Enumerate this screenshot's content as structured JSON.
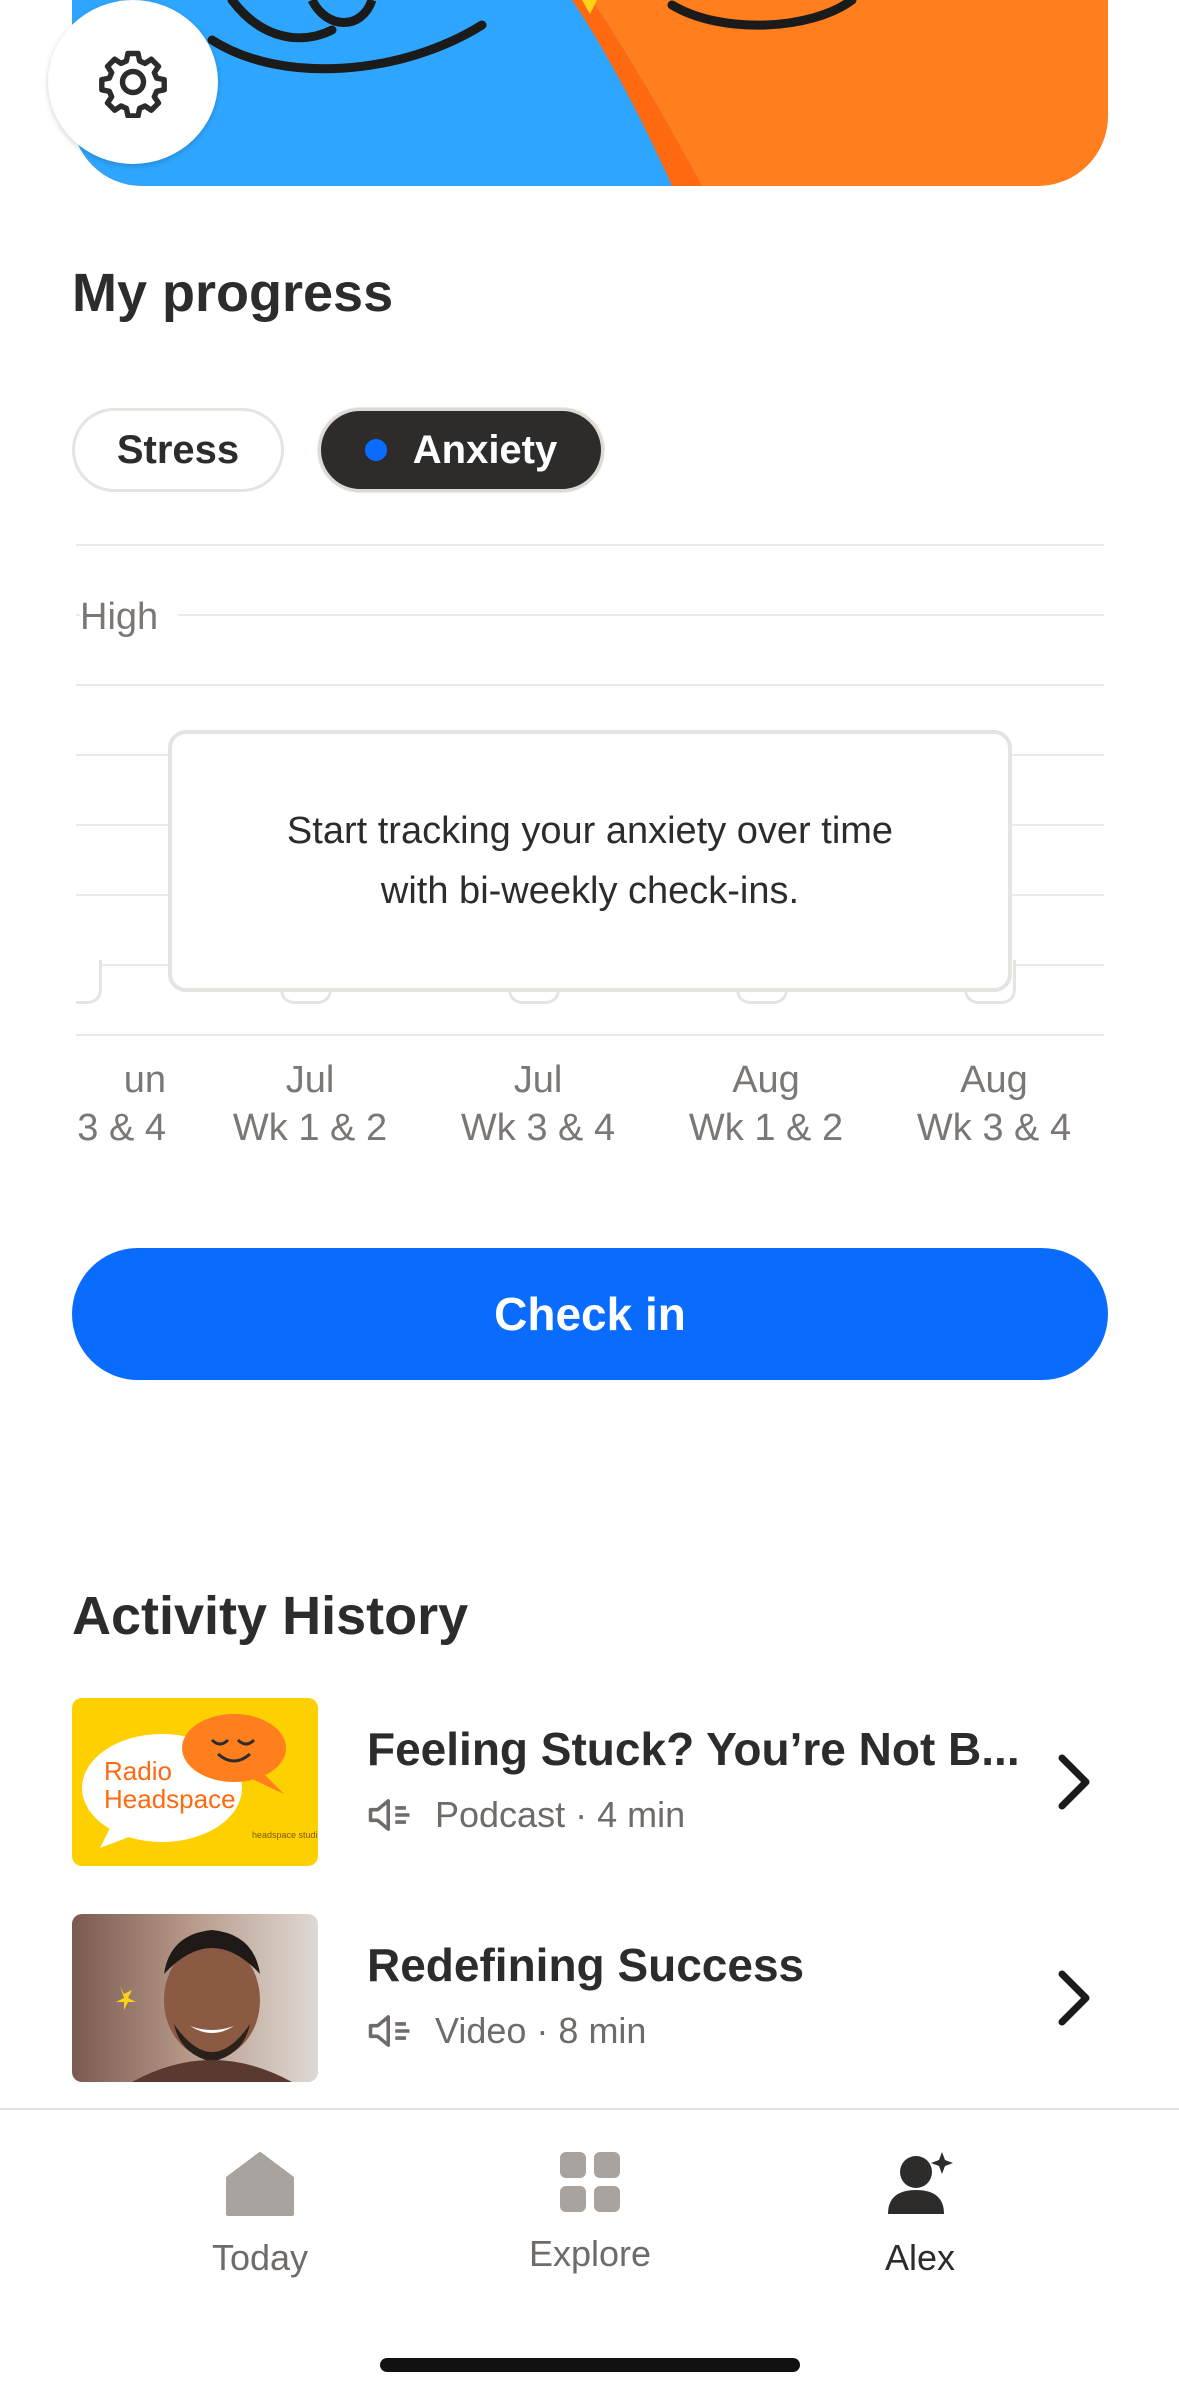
{
  "header": {
    "settings_icon": "gear-icon"
  },
  "progress": {
    "title": "My progress",
    "tabs": [
      {
        "label": "Stress",
        "active": false
      },
      {
        "label": "Anxiety",
        "active": true
      }
    ],
    "chart": {
      "y_label": "High",
      "empty_message_line1": "Start tracking your anxiety over time",
      "empty_message_line2": "with bi-weekly check-ins.",
      "x_labels": [
        {
          "month": "un",
          "weeks": "3 & 4"
        },
        {
          "month": "Jul",
          "weeks": "Wk 1 & 2"
        },
        {
          "month": "Jul",
          "weeks": "Wk 3 & 4"
        },
        {
          "month": "Aug",
          "weeks": "Wk 1 & 2"
        },
        {
          "month": "Aug",
          "weeks": "Wk 3 & 4"
        }
      ]
    },
    "checkin_label": "Check in"
  },
  "activity": {
    "title": "Activity History",
    "items": [
      {
        "title": "Feeling Stuck? You’re Not B...",
        "meta": "Podcast · 4 min",
        "thumb_text_1": "Radio",
        "thumb_text_2": "Headspace",
        "thumb_text_3": "headspace studios"
      },
      {
        "title": "Redefining Success",
        "meta": "Video · 8 min"
      }
    ]
  },
  "nav": {
    "items": [
      {
        "label": "Today",
        "icon": "home-icon"
      },
      {
        "label": "Explore",
        "icon": "grid-icon"
      },
      {
        "label": "Alex",
        "icon": "profile-icon"
      }
    ]
  },
  "colors": {
    "accent": "#0a6cff",
    "orange": "#ff7f1f",
    "sky": "#2ea6ff",
    "dark": "#2d2c2b"
  }
}
